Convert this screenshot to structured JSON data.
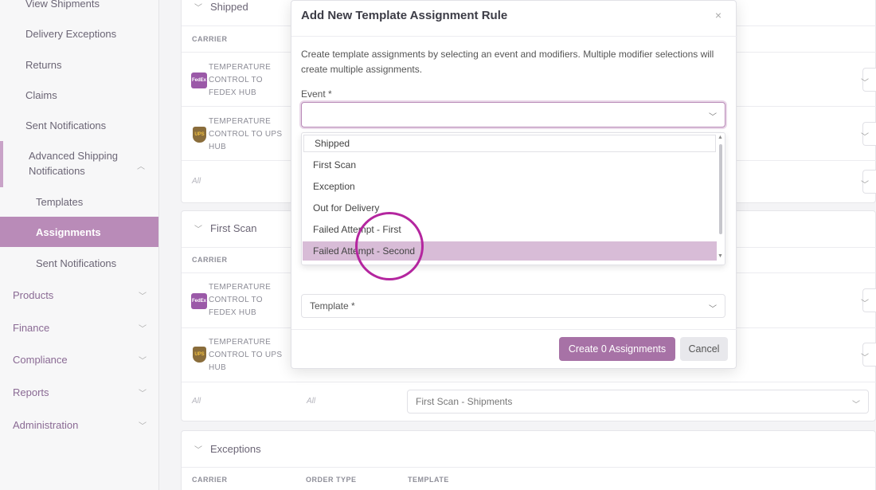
{
  "sidebar": {
    "items": [
      {
        "label": "View Shipments"
      },
      {
        "label": "Delivery Exceptions"
      },
      {
        "label": "Returns"
      },
      {
        "label": "Claims"
      },
      {
        "label": "Sent Notifications"
      }
    ],
    "asn": "Advanced Shipping Notifications",
    "asn_sub": [
      {
        "label": "Templates"
      },
      {
        "label": "Assignments"
      },
      {
        "label": "Sent Notifications"
      }
    ],
    "sections": [
      {
        "label": "Products"
      },
      {
        "label": "Finance"
      },
      {
        "label": "Compliance"
      },
      {
        "label": "Reports"
      },
      {
        "label": "Administration"
      }
    ]
  },
  "cards": {
    "shipped": {
      "title": "Shipped",
      "col_carrier": "CARRIER",
      "rows": [
        {
          "carrier": "TEMPERATURE CONTROL TO FEDEX HUB"
        },
        {
          "carrier": "TEMPERATURE CONTROL TO UPS HUB"
        }
      ],
      "all": "All"
    },
    "first_scan": {
      "title": "First Scan",
      "col_carrier": "CARRIER",
      "rows": [
        {
          "carrier": "TEMPERATURE CONTROL TO FEDEX HUB"
        },
        {
          "carrier": "TEMPERATURE CONTROL TO UPS HUB"
        }
      ],
      "all_carrier": "All",
      "all_order": "All",
      "template_value": "First Scan - Shipments"
    },
    "exceptions": {
      "title": "Exceptions",
      "col_carrier": "CARRIER",
      "col_order": "ORDER TYPE",
      "col_template": "TEMPLATE"
    }
  },
  "modal": {
    "title": "Add New Template Assignment Rule",
    "close": "×",
    "description": "Create template assignments by selecting an event and modifiers. Multiple modifier selections will create multiple assignments.",
    "event_label": "Event *",
    "event_value": "",
    "options": [
      {
        "label": "Shipped"
      },
      {
        "label": "First Scan"
      },
      {
        "label": "Exception"
      },
      {
        "label": "Out for Delivery"
      },
      {
        "label": "Failed Attempt - First"
      },
      {
        "label": "Failed Attempt - Second"
      }
    ],
    "template_placeholder": "Template *",
    "create_label": "Create 0 Assignments",
    "cancel_label": "Cancel"
  },
  "icons": {
    "chevron": "chevron-down-icon",
    "fedex": "fedex-logo",
    "ups": "ups-logo"
  },
  "colors": {
    "accent": "#b98bb8",
    "button": "#a772a6"
  }
}
